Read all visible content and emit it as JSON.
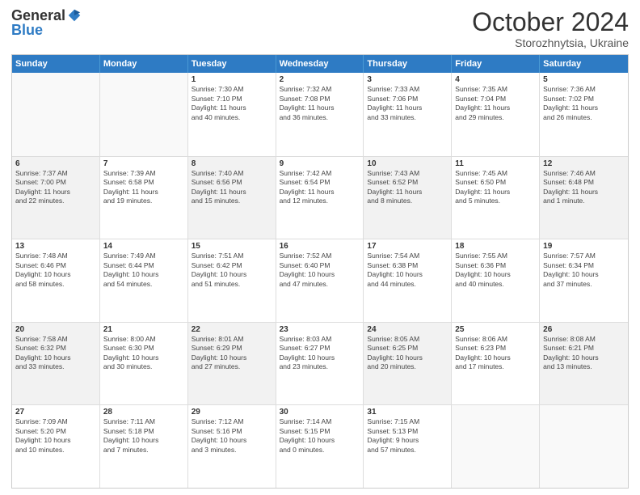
{
  "header": {
    "logo_general": "General",
    "logo_blue": "Blue",
    "month_title": "October 2024",
    "subtitle": "Storozhnytsia, Ukraine"
  },
  "days": [
    "Sunday",
    "Monday",
    "Tuesday",
    "Wednesday",
    "Thursday",
    "Friday",
    "Saturday"
  ],
  "weeks": [
    [
      {
        "day": "",
        "content": "",
        "empty": true
      },
      {
        "day": "",
        "content": "",
        "empty": true
      },
      {
        "day": "1",
        "content": "Sunrise: 7:30 AM\nSunset: 7:10 PM\nDaylight: 11 hours\nand 40 minutes.",
        "empty": false
      },
      {
        "day": "2",
        "content": "Sunrise: 7:32 AM\nSunset: 7:08 PM\nDaylight: 11 hours\nand 36 minutes.",
        "empty": false
      },
      {
        "day": "3",
        "content": "Sunrise: 7:33 AM\nSunset: 7:06 PM\nDaylight: 11 hours\nand 33 minutes.",
        "empty": false
      },
      {
        "day": "4",
        "content": "Sunrise: 7:35 AM\nSunset: 7:04 PM\nDaylight: 11 hours\nand 29 minutes.",
        "empty": false
      },
      {
        "day": "5",
        "content": "Sunrise: 7:36 AM\nSunset: 7:02 PM\nDaylight: 11 hours\nand 26 minutes.",
        "empty": false
      }
    ],
    [
      {
        "day": "6",
        "content": "Sunrise: 7:37 AM\nSunset: 7:00 PM\nDaylight: 11 hours\nand 22 minutes.",
        "empty": false,
        "shaded": true
      },
      {
        "day": "7",
        "content": "Sunrise: 7:39 AM\nSunset: 6:58 PM\nDaylight: 11 hours\nand 19 minutes.",
        "empty": false
      },
      {
        "day": "8",
        "content": "Sunrise: 7:40 AM\nSunset: 6:56 PM\nDaylight: 11 hours\nand 15 minutes.",
        "empty": false,
        "shaded": true
      },
      {
        "day": "9",
        "content": "Sunrise: 7:42 AM\nSunset: 6:54 PM\nDaylight: 11 hours\nand 12 minutes.",
        "empty": false
      },
      {
        "day": "10",
        "content": "Sunrise: 7:43 AM\nSunset: 6:52 PM\nDaylight: 11 hours\nand 8 minutes.",
        "empty": false,
        "shaded": true
      },
      {
        "day": "11",
        "content": "Sunrise: 7:45 AM\nSunset: 6:50 PM\nDaylight: 11 hours\nand 5 minutes.",
        "empty": false
      },
      {
        "day": "12",
        "content": "Sunrise: 7:46 AM\nSunset: 6:48 PM\nDaylight: 11 hours\nand 1 minute.",
        "empty": false,
        "shaded": true
      }
    ],
    [
      {
        "day": "13",
        "content": "Sunrise: 7:48 AM\nSunset: 6:46 PM\nDaylight: 10 hours\nand 58 minutes.",
        "empty": false
      },
      {
        "day": "14",
        "content": "Sunrise: 7:49 AM\nSunset: 6:44 PM\nDaylight: 10 hours\nand 54 minutes.",
        "empty": false,
        "shaded": false
      },
      {
        "day": "15",
        "content": "Sunrise: 7:51 AM\nSunset: 6:42 PM\nDaylight: 10 hours\nand 51 minutes.",
        "empty": false
      },
      {
        "day": "16",
        "content": "Sunrise: 7:52 AM\nSunset: 6:40 PM\nDaylight: 10 hours\nand 47 minutes.",
        "empty": false
      },
      {
        "day": "17",
        "content": "Sunrise: 7:54 AM\nSunset: 6:38 PM\nDaylight: 10 hours\nand 44 minutes.",
        "empty": false
      },
      {
        "day": "18",
        "content": "Sunrise: 7:55 AM\nSunset: 6:36 PM\nDaylight: 10 hours\nand 40 minutes.",
        "empty": false
      },
      {
        "day": "19",
        "content": "Sunrise: 7:57 AM\nSunset: 6:34 PM\nDaylight: 10 hours\nand 37 minutes.",
        "empty": false
      }
    ],
    [
      {
        "day": "20",
        "content": "Sunrise: 7:58 AM\nSunset: 6:32 PM\nDaylight: 10 hours\nand 33 minutes.",
        "empty": false,
        "shaded": true
      },
      {
        "day": "21",
        "content": "Sunrise: 8:00 AM\nSunset: 6:30 PM\nDaylight: 10 hours\nand 30 minutes.",
        "empty": false
      },
      {
        "day": "22",
        "content": "Sunrise: 8:01 AM\nSunset: 6:29 PM\nDaylight: 10 hours\nand 27 minutes.",
        "empty": false,
        "shaded": true
      },
      {
        "day": "23",
        "content": "Sunrise: 8:03 AM\nSunset: 6:27 PM\nDaylight: 10 hours\nand 23 minutes.",
        "empty": false
      },
      {
        "day": "24",
        "content": "Sunrise: 8:05 AM\nSunset: 6:25 PM\nDaylight: 10 hours\nand 20 minutes.",
        "empty": false,
        "shaded": true
      },
      {
        "day": "25",
        "content": "Sunrise: 8:06 AM\nSunset: 6:23 PM\nDaylight: 10 hours\nand 17 minutes.",
        "empty": false
      },
      {
        "day": "26",
        "content": "Sunrise: 8:08 AM\nSunset: 6:21 PM\nDaylight: 10 hours\nand 13 minutes.",
        "empty": false,
        "shaded": true
      }
    ],
    [
      {
        "day": "27",
        "content": "Sunrise: 7:09 AM\nSunset: 5:20 PM\nDaylight: 10 hours\nand 10 minutes.",
        "empty": false
      },
      {
        "day": "28",
        "content": "Sunrise: 7:11 AM\nSunset: 5:18 PM\nDaylight: 10 hours\nand 7 minutes.",
        "empty": false
      },
      {
        "day": "29",
        "content": "Sunrise: 7:12 AM\nSunset: 5:16 PM\nDaylight: 10 hours\nand 3 minutes.",
        "empty": false
      },
      {
        "day": "30",
        "content": "Sunrise: 7:14 AM\nSunset: 5:15 PM\nDaylight: 10 hours\nand 0 minutes.",
        "empty": false
      },
      {
        "day": "31",
        "content": "Sunrise: 7:15 AM\nSunset: 5:13 PM\nDaylight: 9 hours\nand 57 minutes.",
        "empty": false
      },
      {
        "day": "",
        "content": "",
        "empty": true
      },
      {
        "day": "",
        "content": "",
        "empty": true
      }
    ]
  ]
}
